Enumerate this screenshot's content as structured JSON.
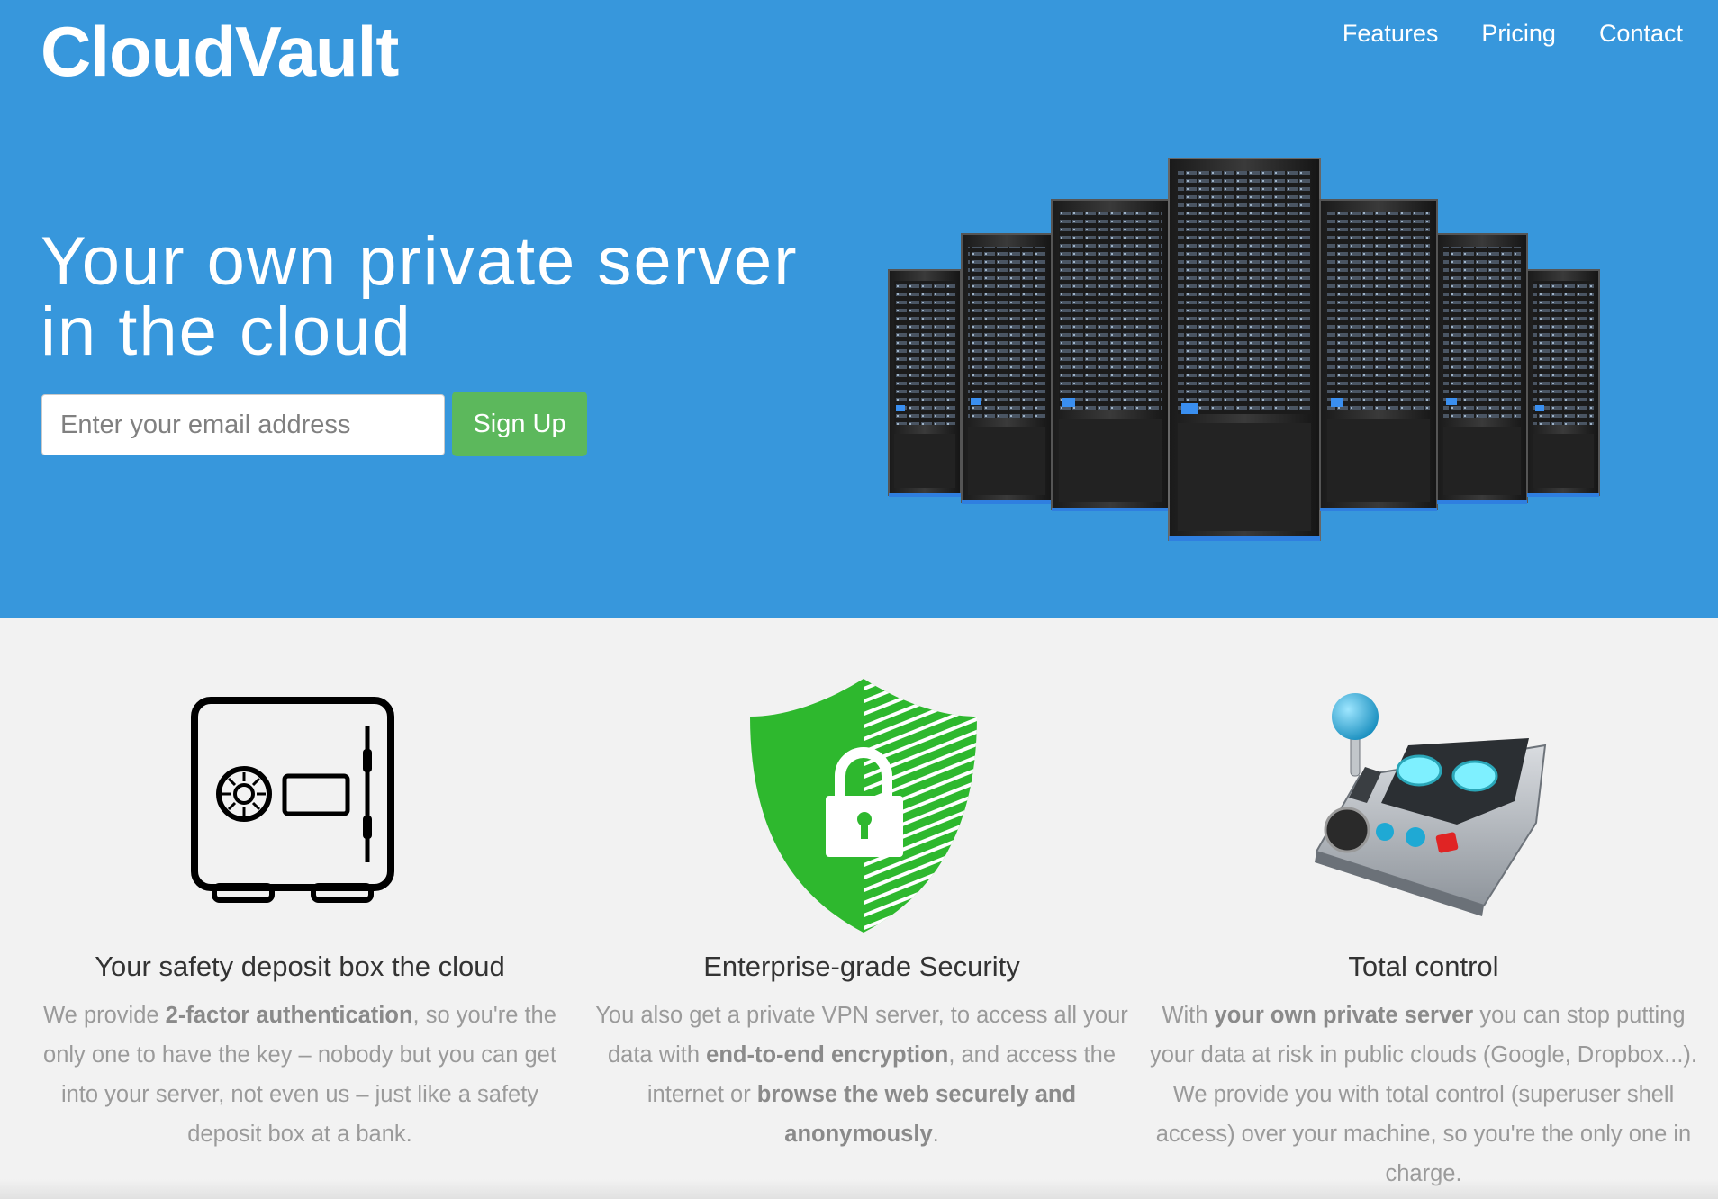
{
  "header": {
    "brand": "CloudVault",
    "nav": [
      "Features",
      "Pricing",
      "Contact"
    ]
  },
  "hero": {
    "headline_line1": "Your own private server",
    "headline_line2": "in the cloud",
    "email_placeholder": "Enter your email address",
    "email_value": "",
    "signup_label": "Sign Up"
  },
  "features": [
    {
      "title": "Your safety deposit box the cloud",
      "icon": "safe-icon",
      "body": [
        {
          "text": "We provide "
        },
        {
          "text": "2-factor authentication",
          "bold": true
        },
        {
          "text": ", so you're the only one to have the key – nobody but you can get into your server, not even us – just like a safety deposit box at a bank."
        }
      ]
    },
    {
      "title": "Enterprise-grade Security",
      "icon": "shield-lock-icon",
      "body": [
        {
          "text": "You also get a private VPN server, to access all your data with "
        },
        {
          "text": "end-to-end encryption",
          "bold": true
        },
        {
          "text": ", and access the internet or "
        },
        {
          "text": "browse the web securely and anonymously",
          "bold": true
        },
        {
          "text": "."
        }
      ]
    },
    {
      "title": "Total control",
      "icon": "joystick-control-panel-icon",
      "body": [
        {
          "text": "With "
        },
        {
          "text": "your own private server",
          "bold": true
        },
        {
          "text": " you can stop putting your data at risk in public clouds (Google, Dropbox...). We provide you with total control (superuser shell access) over your machine, so you're the only one in charge."
        }
      ]
    }
  ],
  "colors": {
    "hero_bg": "#3797dc",
    "signup_button": "#5cb85c",
    "page_bg": "#f2f2f2",
    "shield_green": "#2eb82e"
  }
}
